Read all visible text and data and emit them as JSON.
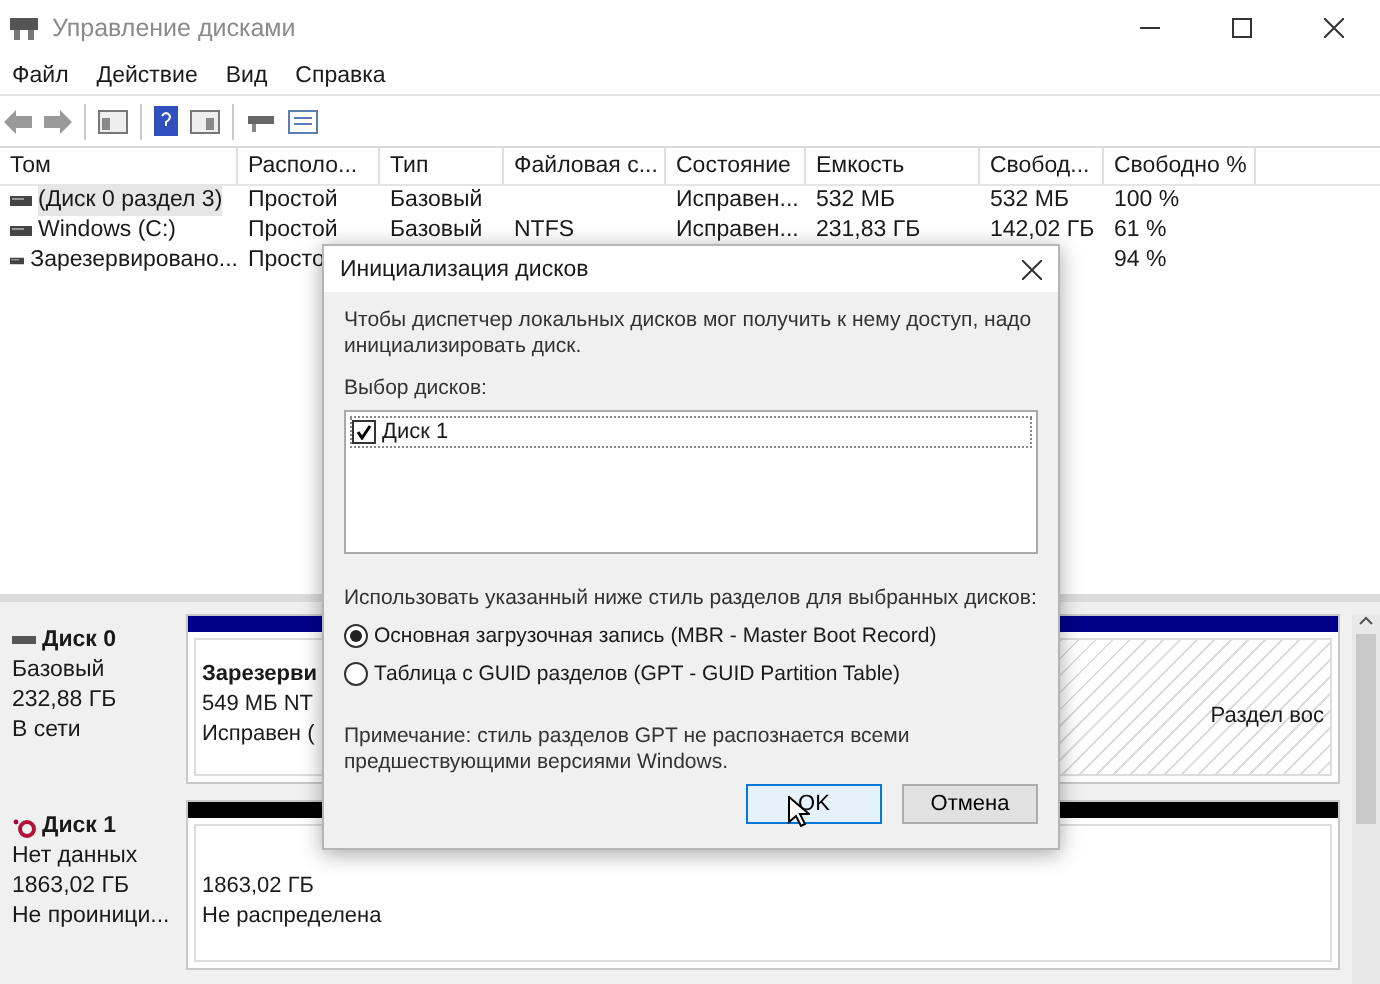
{
  "window": {
    "title": "Управление дисками"
  },
  "menu": [
    "Файл",
    "Действие",
    "Вид",
    "Справка"
  ],
  "table": {
    "columns": [
      "Том",
      "Располо...",
      "Тип",
      "Файловая с...",
      "Состояние",
      "Емкость",
      "Свобод...",
      "Свободно %"
    ],
    "rows": [
      {
        "selected": true,
        "volume": "(Диск 0 раздел 3)",
        "layout": "Простой",
        "type": "Базовый",
        "status": "Исправен...",
        "capacity": "532 МБ",
        "free": "532 МБ",
        "free_pct": "100 %"
      },
      {
        "selected": false,
        "volume": "Windows (C:)",
        "layout": "Простой",
        "type": "Базовый",
        "file_system": "NTFS",
        "status": "Исправен...",
        "capacity": "231,83 ГБ",
        "free": "142,02 ГБ",
        "free_pct": "61 %"
      },
      {
        "selected": false,
        "volume": "Зарезервировано...",
        "layout": "Просто",
        "free_pct": "94 %"
      }
    ]
  },
  "disks": [
    {
      "kind": "online",
      "name": "Диск 0",
      "lines": [
        "Базовый",
        "232,88 ГБ",
        "В сети"
      ],
      "partitions": [
        {
          "kind": "primary",
          "title": "Зарезерви",
          "lines": [
            "549 МБ NT",
            "Исправен ("
          ]
        },
        {
          "kind": "recovery",
          "lines": [
            "Раздел вос"
          ]
        }
      ]
    },
    {
      "kind": "uninitialized",
      "name": "Диск 1",
      "lines": [
        "Нет данных",
        "1863,02 ГБ",
        "Не проиници..."
      ],
      "partitions": [
        {
          "kind": "unallocated",
          "lines": [
            "1863,02 ГБ",
            "Не распределена"
          ]
        }
      ]
    }
  ],
  "dialog": {
    "title": "Инициализация дисков",
    "intro": "Чтобы диспетчер локальных дисков мог получить к нему доступ, надо инициализировать диск.",
    "list_label": "Выбор дисков:",
    "disks": [
      {
        "label": "Диск 1",
        "checked": true
      }
    ],
    "style_label": "Использовать указанный ниже стиль разделов для выбранных дисков:",
    "styles": [
      {
        "label": "Основная загрузочная запись (MBR - Master Boot Record)",
        "selected": true
      },
      {
        "label": "Таблица с GUID разделов (GPT - GUID Partition Table)",
        "selected": false
      }
    ],
    "note": "Примечание: стиль разделов GPT не распознается всеми предшествующими версиями Windows.",
    "buttons": [
      {
        "label": "OK",
        "kind": "default"
      },
      {
        "label": "Отмена",
        "kind": "normal"
      }
    ]
  }
}
